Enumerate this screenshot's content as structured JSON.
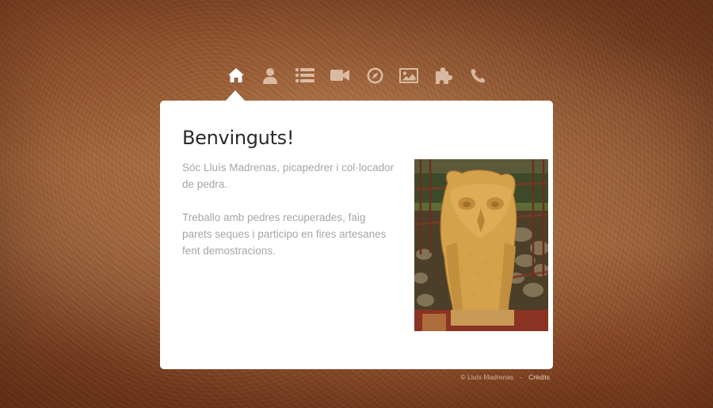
{
  "nav": {
    "items": [
      {
        "icon": "home-icon",
        "active": true
      },
      {
        "icon": "user-icon",
        "active": false
      },
      {
        "icon": "list-icon",
        "active": false
      },
      {
        "icon": "video-camera-icon",
        "active": false
      },
      {
        "icon": "compass-icon",
        "active": false
      },
      {
        "icon": "image-icon",
        "active": false
      },
      {
        "icon": "puzzle-icon",
        "active": false
      },
      {
        "icon": "phone-icon",
        "active": false
      }
    ]
  },
  "panel": {
    "title": "Benvinguts!",
    "paragraph_1": "Sóc Lluís Madrenas, picapedrer i col·locador de pedra.",
    "paragraph_2": "Treballo amb pedres recuperades, faig parets seques i participo en fires artesanes fent demostracions.",
    "photo_alt": "owl stone sculpture"
  },
  "footer": {
    "copyright": "© Lluís Madrenas",
    "separator": "-",
    "credits_label": "Crèdits"
  },
  "colors": {
    "panel_background": "#ffffff",
    "title": "#2a2a2a",
    "body_text": "#a6a6a6",
    "background_brown": "#b07446"
  }
}
